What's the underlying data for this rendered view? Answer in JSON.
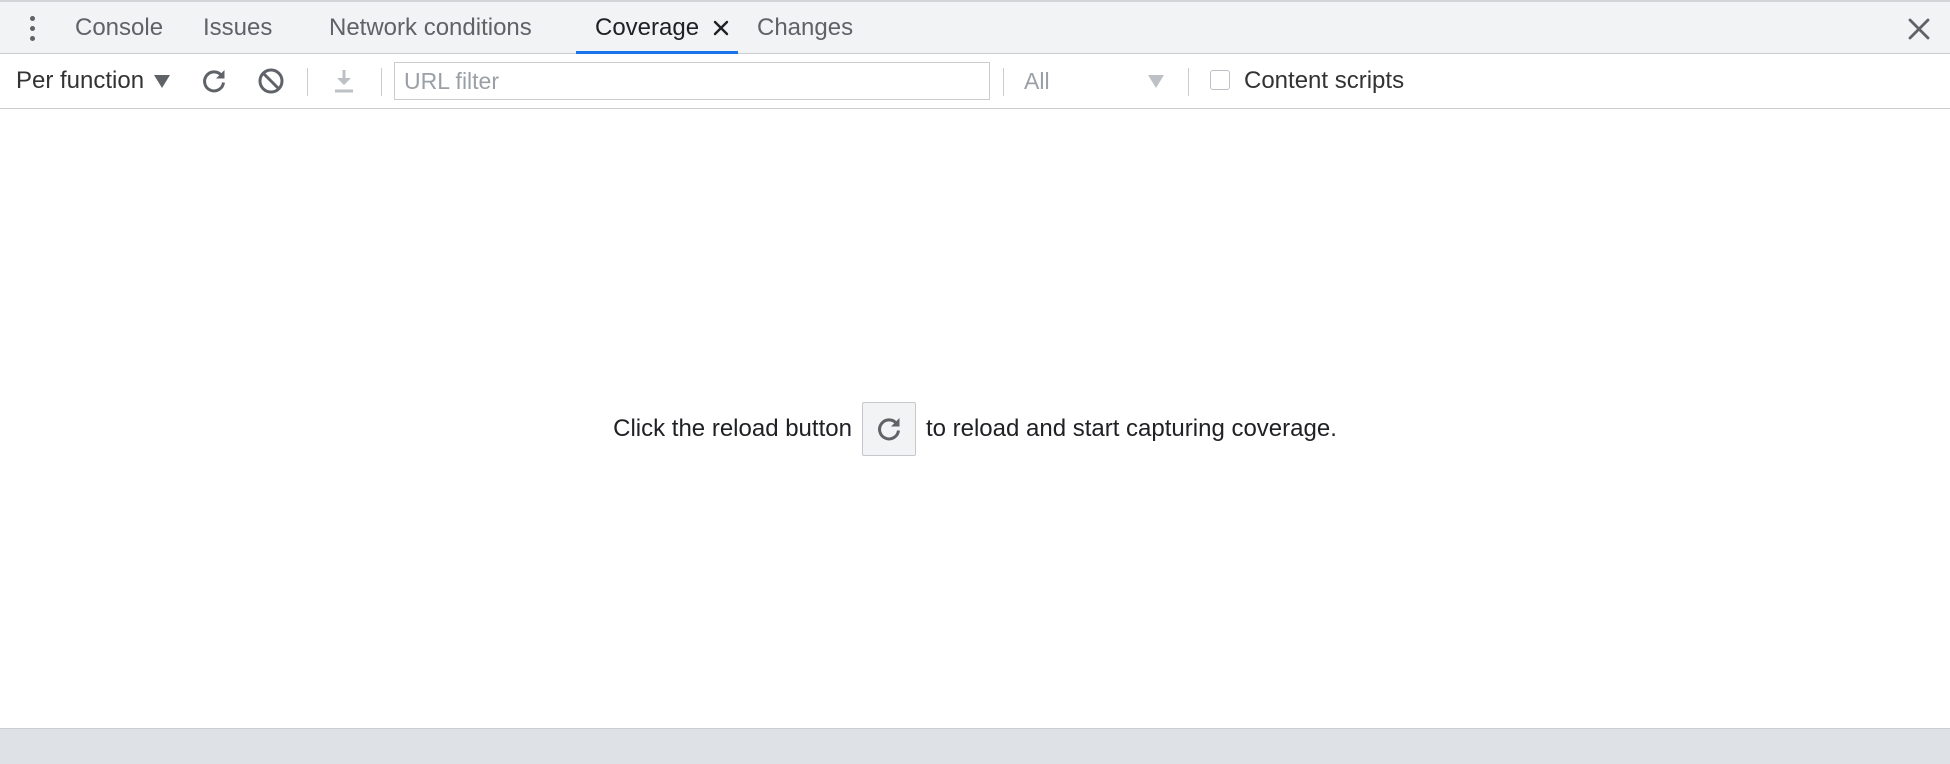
{
  "tabs": [
    {
      "label": "Console"
    },
    {
      "label": "Issues"
    },
    {
      "label": "Network conditions"
    },
    {
      "label": "Coverage",
      "selected": true,
      "closable": true
    },
    {
      "label": "Changes"
    }
  ],
  "toolbar": {
    "granularity": "Per function",
    "url_filter_placeholder": "URL filter",
    "type_filter": "All",
    "content_scripts_label": "Content scripts",
    "content_scripts_checked": false
  },
  "empty_state": {
    "before": "Click the reload button",
    "after": "to reload and start capturing coverage."
  },
  "colors": {
    "accent": "#1a73e8",
    "icon": "#5f6368",
    "tabbar_bg": "#f1f3f4"
  },
  "icons": [
    "more-vert-icon",
    "close-tab-icon",
    "close-drawer-icon",
    "reload-icon",
    "clear-icon",
    "download-icon",
    "chevron-down-icon"
  ]
}
